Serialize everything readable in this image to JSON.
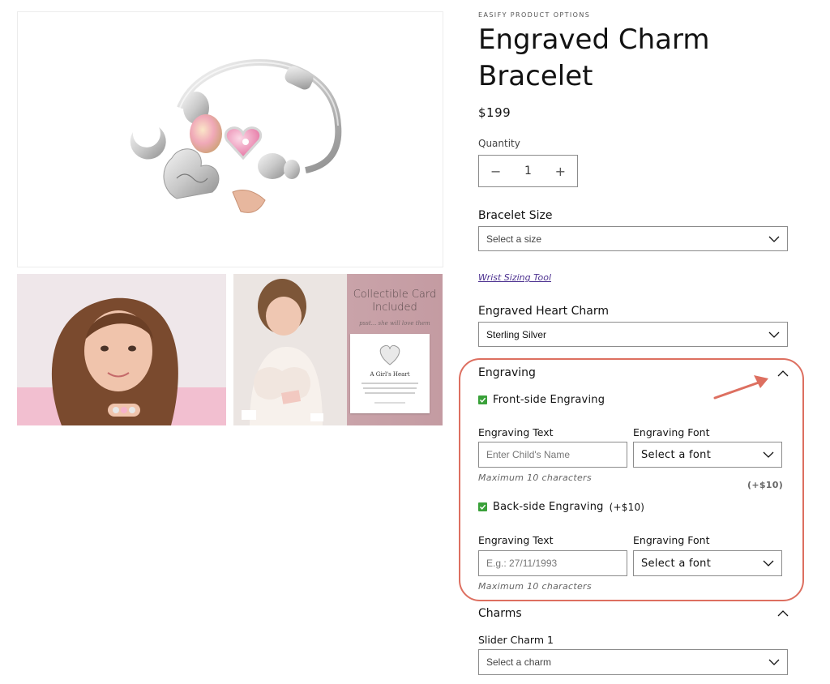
{
  "gallery": {
    "card_title": "Collectible Card Included",
    "card_sub": "psst... she will love them",
    "card_paper_title": "A Girl's Heart"
  },
  "product": {
    "vendor": "EASIFY PRODUCT OPTIONS",
    "title": "Engraved Charm Bracelet",
    "price": "$199",
    "quantity_label": "Quantity",
    "quantity_value": "1",
    "minus": "−",
    "plus": "+"
  },
  "options": {
    "bracelet_size_label": "Bracelet Size",
    "bracelet_size_value": "Select a size",
    "wrist_tool_link": "Wrist Sizing Tool",
    "heart_charm_label": "Engraved Heart Charm",
    "heart_charm_value": "Sterling Silver"
  },
  "engraving": {
    "section_title": "Engraving",
    "front_label": "Front-side Engraving",
    "front_text_label": "Engraving Text",
    "front_text_placeholder": "Enter Child's Name",
    "front_font_label": "Engraving Font",
    "front_font_value": "Select a font",
    "front_hint": "Maximum 10 characters",
    "price_addon": "(+$10)",
    "back_label": "Back-side Engraving",
    "back_price": "(+$10)",
    "back_text_label": "Engraving Text",
    "back_text_placeholder": "E.g.: 27/11/1993",
    "back_font_label": "Engraving Font",
    "back_font_value": "Select a font",
    "back_hint": "Maximum 10 characters"
  },
  "charms": {
    "section_title": "Charms",
    "slider1_label": "Slider Charm 1",
    "slider1_value": "Select a charm"
  },
  "colors": {
    "highlight": "#dd6f60",
    "checkbox": "#3aa13a",
    "link": "#4b2f8f"
  }
}
